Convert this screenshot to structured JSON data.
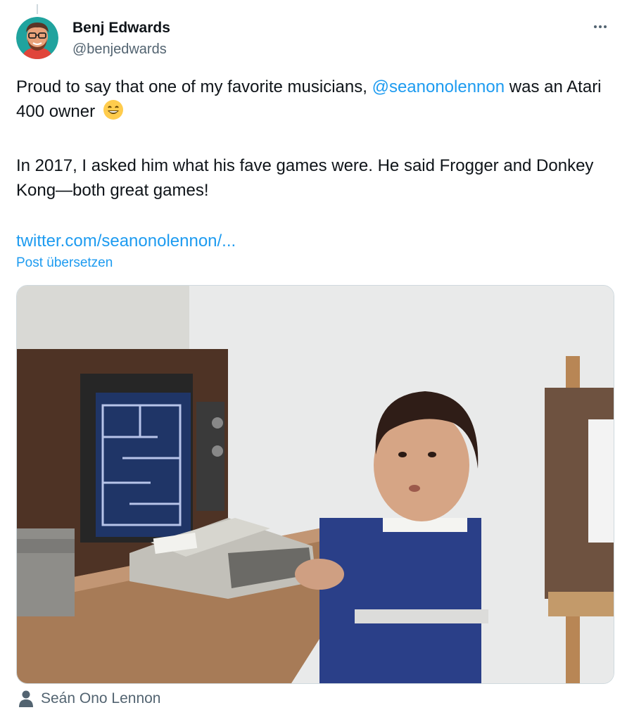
{
  "tweet": {
    "author": {
      "display_name": "Benj Edwards",
      "handle": "@benjedwards",
      "avatar_icon": "avatar-illustration"
    },
    "text": {
      "p1_before": "Proud to say that one of my favorite musicians, ",
      "mention": "@seanonolennon",
      "p1_after": " was an Atari 400 owner ",
      "emoji": "grinning-face-with-smiling-eyes",
      "p2": "In 2017, I asked him what his fave games were. He said Frogger and Donkey Kong—both great games!",
      "link": "twitter.com/seanonolennon/..."
    },
    "translate_label": "Post übersetzen",
    "more_icon": "more-horizontal-icon",
    "media": {
      "description_icon": "photo",
      "tagged_user_label": "Seán Ono Lennon",
      "tagged_icon": "person-icon"
    }
  },
  "colors": {
    "text": "#0f1419",
    "secondary": "#536471",
    "accent": "#1d9bf0",
    "border": "#cfd9de"
  }
}
